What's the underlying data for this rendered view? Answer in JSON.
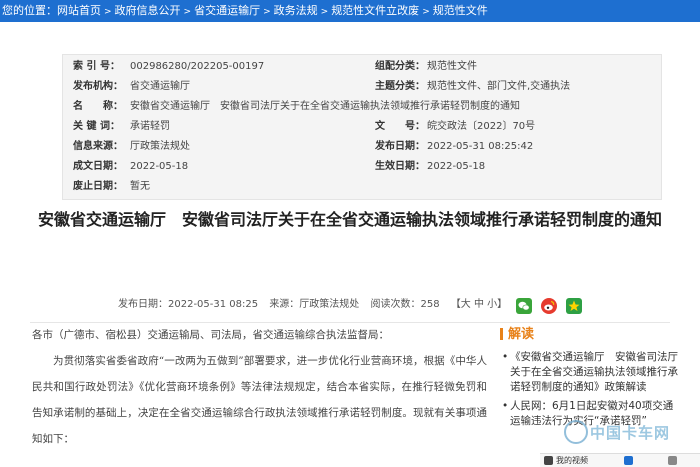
{
  "breadcrumb": {
    "prefix": "您的位置：",
    "items": [
      "网站首页",
      "政府信息公开",
      "省交通运输厅",
      "政务法规",
      "规范性文件立改废",
      "规范性文件"
    ]
  },
  "meta": {
    "rows": [
      {
        "k1": "索 引 号：",
        "v1": "002986280/202205-00197",
        "k2": "组配分类：",
        "v2": "规范性文件"
      },
      {
        "k1": "发布机构：",
        "v1": "省交通运输厅",
        "k2": "主题分类：",
        "v2": "规范性文件、部门文件,交通执法"
      },
      {
        "k1": "名　　称：",
        "v1": "安徽省交通运输厅　安徽省司法厅关于在全省交通运输执法领域推行承诺轻罚制度的通知",
        "k2": "",
        "v2": ""
      },
      {
        "k1": "关 键 词：",
        "v1": "承诺轻罚",
        "k2": "文　　号：",
        "v2": "皖交政法〔2022〕70号"
      },
      {
        "k1": "信息来源：",
        "v1": "厅政策法规处",
        "k2": "发布日期：",
        "v2": "2022-05-31 08:25:42"
      },
      {
        "k1": "成文日期：",
        "v1": "2022-05-18",
        "k2": "生效日期：",
        "v2": "2022-05-18"
      },
      {
        "k1": "废止日期：",
        "v1": "暂无",
        "k2": "",
        "v2": ""
      }
    ]
  },
  "article": {
    "title": "安徽省交通运输厅　安徽省司法厅关于在全省交通运输执法领域推行承诺轻罚制度的通知",
    "pub_date": "发布日期：2022-05-31 08:25",
    "source": "来源：厅政策法规处",
    "views": "阅读次数：258",
    "fontsize_label": "【大 中 小】",
    "paragraphs": [
      "各市（广德市、宿松县）交通运输局、司法局，省交通运输综合执法监督局：",
      "为贯彻落实省委省政府“一改两为五做到”部署要求，进一步优化行业营商环境，根据《中华人民共和国行政处罚法》《优化营商环境条例》等法律法规规定，结合本省实际，在推行轻微免罚和告知承诺制的基础上，决定在全省交通运输综合行政执法领域推行承诺轻罚制度。现就有关事项通知如下："
    ]
  },
  "share": {
    "icons": [
      "wechat-icon",
      "weibo-icon",
      "qzone-icon"
    ],
    "colors": {
      "wechat": "#3aa53a",
      "weibo": "#e63b2e",
      "qzone": "#2ea044"
    }
  },
  "sidebar": {
    "heading": "解读",
    "items": [
      "《安徽省交通运输厅　安徽省司法厅关于在全省交通运输执法领域推行承诺轻罚制度的通知》政策解读",
      "人民网：6月1日起安徽对40项交通运输违法行为实行“承诺轻罚”"
    ]
  },
  "watermark": {
    "text": "中国卡车网"
  },
  "taskbar": {
    "label": "我的视频"
  },
  "colors": {
    "accent": "#1e6fd0",
    "sidebar_accent": "#e8821a"
  }
}
